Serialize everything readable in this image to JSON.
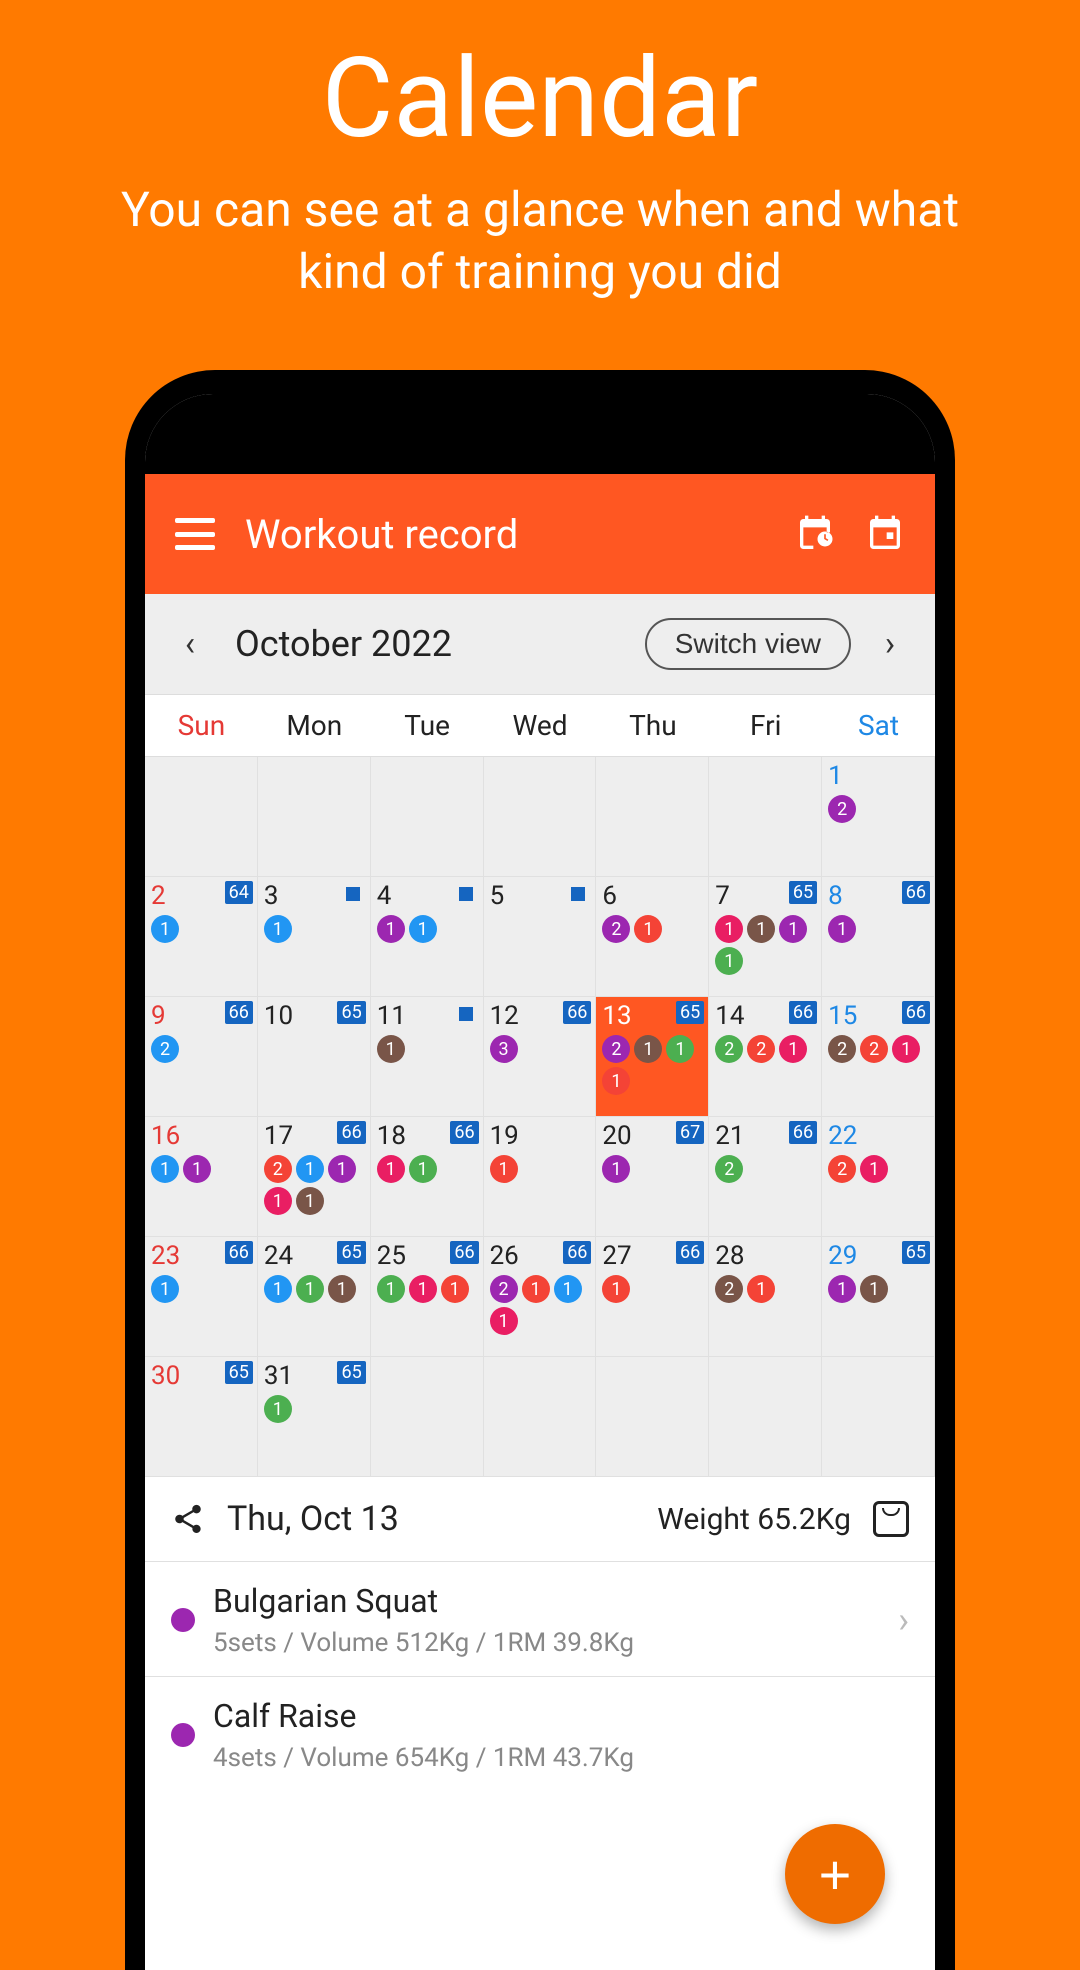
{
  "promo": {
    "title": "Calendar",
    "subtitle": "You can see at a glance when and what kind of training you did"
  },
  "appbar": {
    "title": "Workout record"
  },
  "month": {
    "label": "October 2022",
    "switch_label": "Switch view"
  },
  "dow": [
    "Sun",
    "Mon",
    "Tue",
    "Wed",
    "Thu",
    "Fri",
    "Sat"
  ],
  "detail": {
    "date": "Thu, Oct 13",
    "weight": "Weight 65.2Kg"
  },
  "exercises": [
    {
      "name": "Bulgarian Squat",
      "meta": "5sets / Volume 512Kg / 1RM 39.8Kg",
      "color": "#9c27b0"
    },
    {
      "name": "Calf Raise",
      "meta": "4sets / Volume 654Kg / 1RM 43.7Kg",
      "color": "#9c27b0"
    }
  ],
  "cells": [
    {
      "day": "",
      "type": ""
    },
    {
      "day": "",
      "type": ""
    },
    {
      "day": "",
      "type": ""
    },
    {
      "day": "",
      "type": ""
    },
    {
      "day": "",
      "type": ""
    },
    {
      "day": "",
      "type": ""
    },
    {
      "day": "1",
      "type": "sat",
      "dots": [
        {
          "c": "purple",
          "n": "2"
        }
      ]
    },
    {
      "day": "2",
      "type": "sun",
      "badge": "64",
      "dots": [
        {
          "c": "blue",
          "n": "1"
        }
      ]
    },
    {
      "day": "3",
      "type": "",
      "sq": true,
      "dots": [
        {
          "c": "blue",
          "n": "1"
        }
      ]
    },
    {
      "day": "4",
      "type": "",
      "sq": true,
      "dots": [
        {
          "c": "purple",
          "n": "1"
        },
        {
          "c": "blue",
          "n": "1"
        }
      ]
    },
    {
      "day": "5",
      "type": "",
      "sq": true
    },
    {
      "day": "6",
      "type": "",
      "dots": [
        {
          "c": "purple",
          "n": "2"
        },
        {
          "c": "red",
          "n": "1"
        }
      ]
    },
    {
      "day": "7",
      "type": "",
      "badge": "65",
      "dots": [
        {
          "c": "pink",
          "n": "1"
        },
        {
          "c": "brown",
          "n": "1"
        },
        {
          "c": "purple",
          "n": "1"
        },
        {
          "c": "green",
          "n": "1"
        }
      ]
    },
    {
      "day": "8",
      "type": "sat",
      "badge": "66",
      "dots": [
        {
          "c": "purple",
          "n": "1"
        }
      ]
    },
    {
      "day": "9",
      "type": "sun",
      "badge": "66",
      "dots": [
        {
          "c": "blue",
          "n": "2"
        }
      ]
    },
    {
      "day": "10",
      "type": "",
      "badge": "65"
    },
    {
      "day": "11",
      "type": "",
      "sq": true,
      "dots": [
        {
          "c": "brown",
          "n": "1"
        }
      ]
    },
    {
      "day": "12",
      "type": "",
      "badge": "66",
      "dots": [
        {
          "c": "purple",
          "n": "3"
        }
      ]
    },
    {
      "day": "13",
      "type": "",
      "selected": true,
      "badge": "65",
      "dots": [
        {
          "c": "purple",
          "n": "2"
        },
        {
          "c": "brown",
          "n": "1"
        },
        {
          "c": "green",
          "n": "1"
        },
        {
          "c": "red",
          "n": "1"
        }
      ]
    },
    {
      "day": "14",
      "type": "",
      "badge": "66",
      "dots": [
        {
          "c": "green",
          "n": "2"
        },
        {
          "c": "red",
          "n": "2"
        },
        {
          "c": "pink",
          "n": "1"
        }
      ]
    },
    {
      "day": "15",
      "type": "sat",
      "badge": "66",
      "dots": [
        {
          "c": "brown",
          "n": "2"
        },
        {
          "c": "red",
          "n": "2"
        },
        {
          "c": "pink",
          "n": "1"
        }
      ]
    },
    {
      "day": "16",
      "type": "sun",
      "dots": [
        {
          "c": "blue",
          "n": "1"
        },
        {
          "c": "purple",
          "n": "1"
        }
      ]
    },
    {
      "day": "17",
      "type": "",
      "badge": "66",
      "dots": [
        {
          "c": "red",
          "n": "2"
        },
        {
          "c": "blue",
          "n": "1"
        },
        {
          "c": "purple",
          "n": "1"
        },
        {
          "c": "pink",
          "n": "1"
        },
        {
          "c": "brown",
          "n": "1"
        }
      ]
    },
    {
      "day": "18",
      "type": "",
      "badge": "66",
      "dots": [
        {
          "c": "pink",
          "n": "1"
        },
        {
          "c": "green",
          "n": "1"
        }
      ]
    },
    {
      "day": "19",
      "type": "",
      "dots": [
        {
          "c": "red",
          "n": "1"
        }
      ]
    },
    {
      "day": "20",
      "type": "",
      "badge": "67",
      "dots": [
        {
          "c": "purple",
          "n": "1"
        }
      ]
    },
    {
      "day": "21",
      "type": "",
      "badge": "66",
      "dots": [
        {
          "c": "green",
          "n": "2"
        }
      ]
    },
    {
      "day": "22",
      "type": "sat",
      "dots": [
        {
          "c": "red",
          "n": "2"
        },
        {
          "c": "pink",
          "n": "1"
        }
      ]
    },
    {
      "day": "23",
      "type": "sun",
      "badge": "66",
      "dots": [
        {
          "c": "blue",
          "n": "1"
        }
      ]
    },
    {
      "day": "24",
      "type": "",
      "badge": "65",
      "dots": [
        {
          "c": "blue",
          "n": "1"
        },
        {
          "c": "green",
          "n": "1"
        },
        {
          "c": "brown",
          "n": "1"
        }
      ]
    },
    {
      "day": "25",
      "type": "",
      "badge": "66",
      "dots": [
        {
          "c": "green",
          "n": "1"
        },
        {
          "c": "pink",
          "n": "1"
        },
        {
          "c": "red",
          "n": "1"
        }
      ]
    },
    {
      "day": "26",
      "type": "",
      "badge": "66",
      "dots": [
        {
          "c": "purple",
          "n": "2"
        },
        {
          "c": "red",
          "n": "1"
        },
        {
          "c": "blue",
          "n": "1"
        },
        {
          "c": "pink",
          "n": "1"
        }
      ]
    },
    {
      "day": "27",
      "type": "",
      "badge": "66",
      "dots": [
        {
          "c": "red",
          "n": "1"
        }
      ]
    },
    {
      "day": "28",
      "type": "",
      "dots": [
        {
          "c": "brown",
          "n": "2"
        },
        {
          "c": "red",
          "n": "1"
        }
      ]
    },
    {
      "day": "29",
      "type": "sat",
      "badge": "65",
      "dots": [
        {
          "c": "purple",
          "n": "1"
        },
        {
          "c": "brown",
          "n": "1"
        }
      ]
    },
    {
      "day": "30",
      "type": "sun",
      "badge": "65"
    },
    {
      "day": "31",
      "type": "",
      "badge": "65",
      "dots": [
        {
          "c": "green",
          "n": "1"
        }
      ]
    },
    {
      "day": "",
      "type": ""
    },
    {
      "day": "",
      "type": ""
    },
    {
      "day": "",
      "type": ""
    },
    {
      "day": "",
      "type": ""
    },
    {
      "day": "",
      "type": ""
    }
  ]
}
